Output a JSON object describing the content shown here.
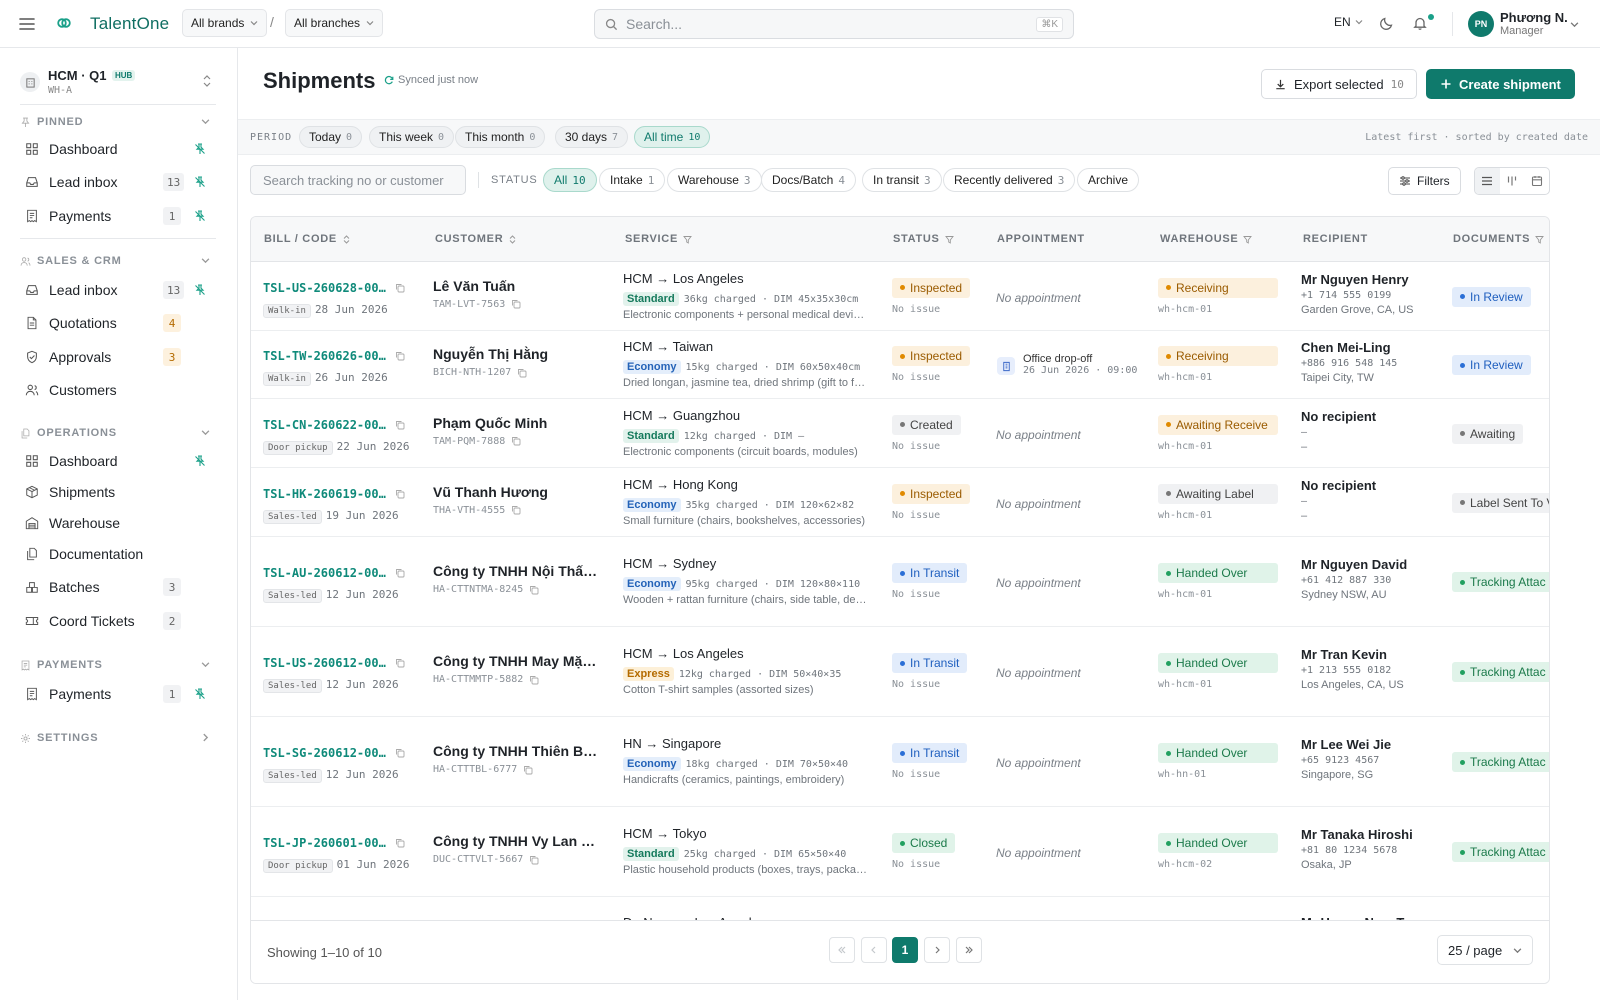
{
  "app": {
    "name": "TalentOne"
  },
  "topbar": {
    "brand_select": "All brands",
    "branch_select": "All branches",
    "separator": "/",
    "search_placeholder": "Search...",
    "search_shortcut": "⌘K",
    "lang": "EN",
    "avatar_initials": "PN",
    "user_name": "Phương N.",
    "user_role": "Manager"
  },
  "sidebar": {
    "workspace": {
      "name": "HCM · Q1",
      "badge": "HUB",
      "code": "WH-A"
    },
    "sections": [
      {
        "label": "PINNED",
        "items": [
          {
            "label": "Dashboard",
            "icon": "grid-icon",
            "count": "",
            "pinned": true
          },
          {
            "label": "Lead inbox",
            "icon": "inbox-icon",
            "count": "13",
            "pinned": true
          },
          {
            "label": "Payments",
            "icon": "receipt-icon",
            "count": "1",
            "pinned": true
          }
        ]
      },
      {
        "label": "SALES & CRM",
        "items": [
          {
            "label": "Lead inbox",
            "icon": "inbox-icon",
            "count": "13",
            "pinned": true
          },
          {
            "label": "Quotations",
            "icon": "document-icon",
            "count": "4",
            "warn": true
          },
          {
            "label": "Approvals",
            "icon": "shield-check-icon",
            "count": "3",
            "warn": true
          },
          {
            "label": "Customers",
            "icon": "users-icon",
            "count": ""
          }
        ]
      },
      {
        "label": "OPERATIONS",
        "items": [
          {
            "label": "Dashboard",
            "icon": "grid-icon",
            "count": "",
            "pinned": true
          },
          {
            "label": "Shipments",
            "icon": "package-icon",
            "count": ""
          },
          {
            "label": "Warehouse",
            "icon": "warehouse-icon",
            "count": ""
          },
          {
            "label": "Documentation",
            "icon": "files-icon",
            "count": ""
          },
          {
            "label": "Batches",
            "icon": "boxes-icon",
            "count": "3"
          },
          {
            "label": "Coord Tickets",
            "icon": "ticket-icon",
            "count": "2"
          }
        ]
      },
      {
        "label": "PAYMENTS",
        "items": [
          {
            "label": "Payments",
            "icon": "receipt-icon",
            "count": "1",
            "pinned": true
          }
        ]
      },
      {
        "label": "SETTINGS",
        "items": []
      }
    ]
  },
  "page": {
    "title": "Shipments",
    "synced": "Synced just now",
    "export_label": "Export selected",
    "export_count": "10",
    "create_label": "Create shipment"
  },
  "period": {
    "label": "PERIOD",
    "chips": [
      {
        "label": "Today",
        "count": "0"
      },
      {
        "label": "This week",
        "count": "0"
      },
      {
        "label": "This month",
        "count": "0"
      },
      {
        "label": "30 days",
        "count": "7"
      },
      {
        "label": "All time",
        "count": "10",
        "active": true
      }
    ],
    "sort_info": "Latest first · sorted by created date"
  },
  "filters": {
    "search_placeholder": "Search tracking no or customer",
    "status_label": "STATUS",
    "chips": [
      {
        "label": "All",
        "count": "10",
        "active": true
      },
      {
        "label": "Intake",
        "count": "1"
      },
      {
        "label": "Warehouse",
        "count": "3"
      },
      {
        "label": "Docs/Batch",
        "count": "4"
      },
      {
        "label": "In transit",
        "count": "3"
      },
      {
        "label": "Recently delivered",
        "count": "3"
      },
      {
        "label": "Archive",
        "count": ""
      }
    ],
    "filters_label": "Filters"
  },
  "table": {
    "columns": [
      "BILL / CODE",
      "CUSTOMER",
      "SERVICE",
      "STATUS",
      "APPOINTMENT",
      "WAREHOUSE",
      "RECIPIENT",
      "DOCUMENTS"
    ],
    "rows": [
      {
        "code": "TSL-US-260628-00…",
        "source": "Walk-in",
        "date": "28 Jun 2026",
        "customer": "Lê Văn Tuấn",
        "cust_code": "TAM-LVT-7563",
        "route": "HCM → Los Angeles",
        "service": "Standard",
        "service_kind": "standard",
        "charged": "36kg charged · DIM 45x35x30cm",
        "goods": "Electronic components + personal medical devices",
        "status": "Inspected",
        "status_color": "amber",
        "issue": "No issue",
        "appointment": "No appointment",
        "appt_time": "",
        "wh_status": "Receiving",
        "wh_color": "amber",
        "wh_code": "wh-hcm-01",
        "recipient": "Mr Nguyen Henry",
        "phone": "+1 714 555 0199",
        "location": "Garden Grove, CA, US",
        "doc": "In Review",
        "doc_color": "blue"
      },
      {
        "code": "TSL-TW-260626-00…",
        "source": "Walk-in",
        "date": "26 Jun 2026",
        "customer": "Nguyễn Thị Hằng",
        "cust_code": "BICH-NTH-1207",
        "route": "HCM → Taiwan",
        "service": "Economy",
        "service_kind": "economy",
        "charged": "15kg charged · DIM 60x50x40cm",
        "goods": "Dried longan, jasmine tea, dried shrimp (gift to family)",
        "status": "Inspected",
        "status_color": "amber",
        "issue": "No issue",
        "appointment": "Office drop-off",
        "appt_time": "26 Jun 2026 · 09:00",
        "wh_status": "Receiving",
        "wh_color": "amber",
        "wh_code": "wh-hcm-01",
        "recipient": "Chen Mei-Ling",
        "phone": "+886 916 548 145",
        "location": "Taipei City, TW",
        "doc": "In Review",
        "doc_color": "blue"
      },
      {
        "code": "TSL-CN-260622-00…",
        "source": "Door pickup",
        "date": "22 Jun 2026",
        "customer": "Phạm Quốc Minh",
        "cust_code": "TAM-PQM-7888",
        "route": "HCM → Guangzhou",
        "service": "Standard",
        "service_kind": "standard",
        "charged": "12kg charged · DIM —",
        "goods": "Electronic components (circuit boards, modules)",
        "status": "Created",
        "status_color": "gray",
        "issue": "No issue",
        "appointment": "No appointment",
        "appt_time": "",
        "wh_status": "Awaiting Receive",
        "wh_color": "amber",
        "wh_code": "wh-hcm-01",
        "recipient": "No recipient",
        "phone": "–",
        "location": "–",
        "doc": "Awaiting",
        "doc_color": "gray"
      },
      {
        "code": "TSL-HK-260619-00…",
        "source": "Sales-led",
        "date": "19 Jun 2026",
        "customer": "Vũ Thanh Hương",
        "cust_code": "THA-VTH-4555",
        "route": "HCM → Hong Kong",
        "service": "Economy",
        "service_kind": "economy",
        "charged": "35kg charged · DIM 120×62×82",
        "goods": "Small furniture (chairs, bookshelves, accessories)",
        "status": "Inspected",
        "status_color": "amber",
        "issue": "No issue",
        "appointment": "No appointment",
        "appt_time": "",
        "wh_status": "Awaiting Label",
        "wh_color": "gray",
        "wh_code": "wh-hcm-01",
        "recipient": "No recipient",
        "phone": "–",
        "location": "–",
        "doc": "Label Sent To V",
        "doc_color": "gray"
      },
      {
        "code": "TSL-AU-260612-00…",
        "source": "Sales-led",
        "date": "12 Jun 2026",
        "customer": "Công ty TNHH Nội Thất …",
        "cust_code": "HA-CTTNTMA-8245",
        "route": "HCM → Sydney",
        "service": "Economy",
        "service_kind": "economy",
        "charged": "95kg charged · DIM 120×80×110",
        "goods": "Wooden + rattan furniture (chairs, side table, decor)",
        "status": "In Transit",
        "status_color": "blue",
        "issue": "No issue",
        "appointment": "No appointment",
        "appt_time": "",
        "wh_status": "Handed Over",
        "wh_color": "green",
        "wh_code": "wh-hcm-01",
        "recipient": "Mr Nguyen David",
        "phone": "+61 412 887 330",
        "location": "Sydney NSW, AU",
        "doc": "Tracking Attac",
        "doc_color": "green"
      },
      {
        "code": "TSL-US-260612-00…",
        "source": "Sales-led",
        "date": "12 Jun 2026",
        "customer": "Công ty TNHH May Mặc …",
        "cust_code": "HA-CTTMMTP-5882",
        "route": "HCM → Los Angeles",
        "service": "Express",
        "service_kind": "express",
        "charged": "12kg charged · DIM 50×40×35",
        "goods": "Cotton T-shirt samples (assorted sizes)",
        "status": "In Transit",
        "status_color": "blue",
        "issue": "No issue",
        "appointment": "No appointment",
        "appt_time": "",
        "wh_status": "Handed Over",
        "wh_color": "green",
        "wh_code": "wh-hcm-01",
        "recipient": "Mr Tran Kevin",
        "phone": "+1 213 555 0182",
        "location": "Los Angeles, CA, US",
        "doc": "Tracking Attac",
        "doc_color": "green"
      },
      {
        "code": "TSL-SG-260612-00…",
        "source": "Sales-led",
        "date": "12 Jun 2026",
        "customer": "Công ty TNHH Thiên Bìn…",
        "cust_code": "HA-CTTTBL-6777",
        "route": "HN → Singapore",
        "service": "Economy",
        "service_kind": "economy",
        "charged": "18kg charged · DIM 70×50×40",
        "goods": "Handicrafts (ceramics, paintings, embroidery)",
        "status": "In Transit",
        "status_color": "blue",
        "issue": "No issue",
        "appointment": "No appointment",
        "appt_time": "",
        "wh_status": "Handed Over",
        "wh_color": "green",
        "wh_code": "wh-hn-01",
        "recipient": "Mr Lee Wei Jie",
        "phone": "+65 9123 4567",
        "location": "Singapore, SG",
        "doc": "Tracking Attac",
        "doc_color": "green"
      },
      {
        "code": "TSL-JP-260601-00…",
        "source": "Door pickup",
        "date": "01 Jun 2026",
        "customer": "Công ty TNHH Vy Lan Tr…",
        "cust_code": "DUC-CTTVLT-5667",
        "route": "HCM → Tokyo",
        "service": "Standard",
        "service_kind": "standard",
        "charged": "25kg charged · DIM 65×50×40",
        "goods": "Plastic household products (boxes, trays, packaging)",
        "status": "Closed",
        "status_color": "green",
        "issue": "No issue",
        "appointment": "No appointment",
        "appt_time": "",
        "wh_status": "Handed Over",
        "wh_color": "green",
        "wh_code": "wh-hcm-02",
        "recipient": "Mr Tanaka Hiroshi",
        "phone": "+81 80 1234 5678",
        "location": "Osaka, JP",
        "doc": "Tracking Attac",
        "doc_color": "green"
      }
    ],
    "partial_row": {
      "route": "Da Nang → Los Angeles",
      "recipient": "Mr Hoang Nam T…"
    }
  },
  "pagination": {
    "showing": "Showing 1–10 of 10",
    "current_page": "1",
    "per_page": "25 / page"
  },
  "colors": {
    "brand": "#0f7a6c",
    "accent": "#1aa089"
  }
}
